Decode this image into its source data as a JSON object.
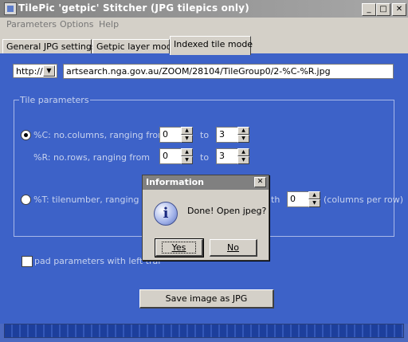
{
  "window": {
    "title": "TilePic 'getpic' Stitcher (JPG tilepics only)",
    "minimize": "_",
    "maximize": "□",
    "close": "✕"
  },
  "menu": [
    "Parameters",
    "Options",
    "Help"
  ],
  "tabs": [
    "General JPG settings",
    "Getpic layer mode",
    "Indexed tile mode"
  ],
  "active_tab": "Indexed tile mode",
  "url": {
    "protocol": "http://",
    "value": "artsearch.nga.gov.au/ZOOM/28104/TileGroup0/2-%C-%R.jpg"
  },
  "tile_parameters": {
    "group_label": "Tile parameters",
    "columns_label": "%C: no.columns, ranging from",
    "columns_from": "0",
    "columns_to": "3",
    "rows_label": "%R: no.rows, ranging from",
    "rows_from": "0",
    "rows_to": "3",
    "to_label": "to",
    "tilenumber_label": "%T: tilenumber, ranging fro",
    "with_fragment": "th",
    "per_row_value": "0",
    "per_row_label": "(columns per row)"
  },
  "pad_label": "pad parameters with left trai",
  "save_button": "Save image as JPG",
  "progress": 1.0,
  "dialog": {
    "title": "Information",
    "message": "Done! Open jpeg?",
    "yes": "Yes",
    "no": "No",
    "close": "✕",
    "icon_glyph": "i"
  },
  "colors": {
    "panel_background": "#3d62c8",
    "label_text": "#c7d2ee",
    "progress_fill": "#1d3f9c"
  },
  "icons": [
    "app-icon",
    "info-icon",
    "dropdown-arrow-icon",
    "spin-up-icon",
    "spin-down-icon"
  ]
}
